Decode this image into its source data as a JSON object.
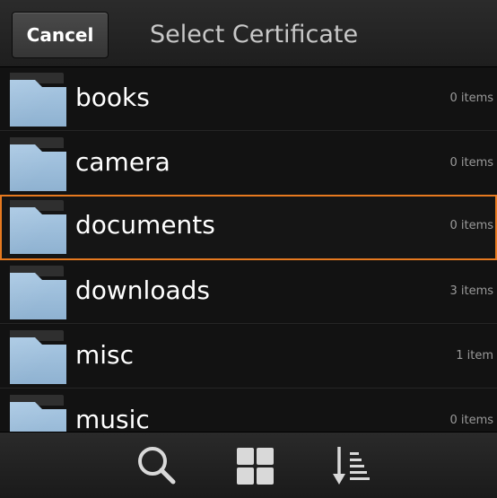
{
  "header": {
    "cancel_label": "Cancel",
    "title": "Select Certificate"
  },
  "folders": [
    {
      "name": "books",
      "count": "0 items",
      "selected": false
    },
    {
      "name": "camera",
      "count": "0 items",
      "selected": false
    },
    {
      "name": "documents",
      "count": "0 items",
      "selected": true
    },
    {
      "name": "downloads",
      "count": "3 items",
      "selected": false
    },
    {
      "name": "misc",
      "count": "1 item",
      "selected": false
    },
    {
      "name": "music",
      "count": "0 items",
      "selected": false
    }
  ],
  "actionbar": {
    "icons": [
      "search-icon",
      "grid-view-icon",
      "sort-icon"
    ]
  },
  "colors": {
    "selection": "#e6791f",
    "folder": "#9fbfdc",
    "background": "#111111"
  }
}
